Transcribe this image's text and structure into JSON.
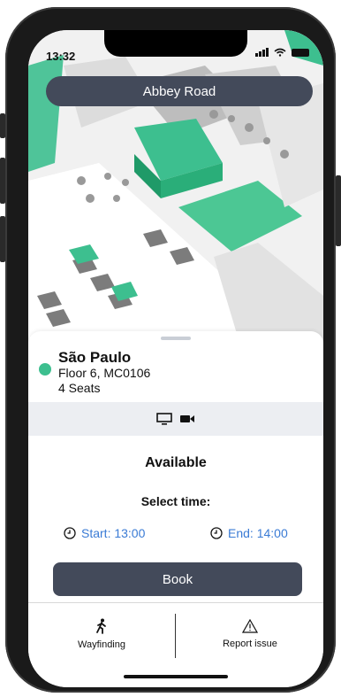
{
  "status": {
    "time": "13:32"
  },
  "header": {
    "title": "Abbey Road"
  },
  "room": {
    "name": "São Paulo",
    "floor": "Floor 6, MC0106",
    "seats": "4 Seats",
    "status_color": "#3dbf8f",
    "equipment_icons": [
      "monitor-icon",
      "video-camera-icon"
    ]
  },
  "availability": {
    "status": "Available"
  },
  "time_select": {
    "label": "Select time:",
    "start": "Start: 13:00",
    "end": "End: 14:00"
  },
  "actions": {
    "book_label": "Book"
  },
  "footer": {
    "wayfinding_label": "Wayfinding",
    "report_label": "Report issue"
  },
  "colors": {
    "accent": "#3a7bd5",
    "primary_dark": "#434a5a",
    "map_green": "#3dbf8f"
  }
}
